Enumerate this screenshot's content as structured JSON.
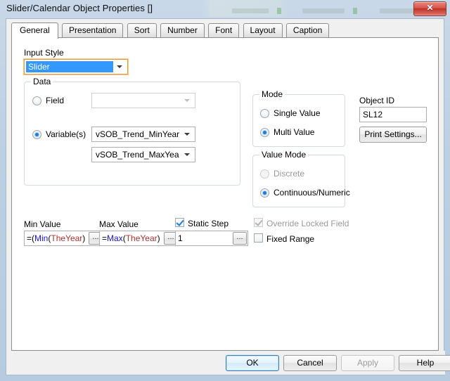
{
  "window": {
    "title": "Slider/Calendar Object Properties []",
    "close_label": "✕"
  },
  "tabs": [
    {
      "label": "General",
      "active": true
    },
    {
      "label": "Presentation",
      "active": false
    },
    {
      "label": "Sort",
      "active": false
    },
    {
      "label": "Number",
      "active": false
    },
    {
      "label": "Font",
      "active": false
    },
    {
      "label": "Layout",
      "active": false
    },
    {
      "label": "Caption",
      "active": false
    }
  ],
  "general": {
    "input_style": {
      "label": "Input Style",
      "value": "Slider"
    },
    "data_group": {
      "title": "Data",
      "field_radio_label": "Field",
      "field_combo_value": "",
      "variables_radio_label": "Variable(s)",
      "variable_1": "vSOB_Trend_MinYear",
      "variable_2": "vSOB_Trend_MaxYear"
    },
    "mode_group": {
      "title": "Mode",
      "options": [
        "Single Value",
        "Multi Value"
      ],
      "selected": "Multi Value"
    },
    "value_mode_group": {
      "title": "Value Mode",
      "options": [
        "Discrete",
        "Continuous/Numeric"
      ],
      "selected": "Continuous/Numeric",
      "disabled_option": "Discrete"
    },
    "object_id": {
      "label": "Object ID",
      "value": "SL12",
      "print_settings_label": "Print Settings..."
    },
    "min_value": {
      "label": "Min Value",
      "tokens": [
        {
          "t": "=(",
          "c": "black"
        },
        {
          "t": "Min",
          "c": "fn"
        },
        {
          "t": "(",
          "c": "black"
        },
        {
          "t": "TheYear",
          "c": "field"
        },
        {
          "t": ")",
          "c": "black"
        }
      ],
      "browse_label": "..."
    },
    "max_value": {
      "label": "Max Value",
      "tokens": [
        {
          "t": "=",
          "c": "black"
        },
        {
          "t": "Max",
          "c": "fn"
        },
        {
          "t": "(",
          "c": "black"
        },
        {
          "t": "TheYear",
          "c": "field"
        },
        {
          "t": ")",
          "c": "black"
        }
      ],
      "browse_label": "..."
    },
    "static_step": {
      "label": "Static Step",
      "checked": true,
      "value": "1",
      "browse_label": "..."
    },
    "override_locked_field": {
      "label": "Override Locked Field",
      "checked": true,
      "enabled": false
    },
    "fixed_range": {
      "label": "Fixed Range",
      "checked": false,
      "enabled": true
    }
  },
  "footer": {
    "ok": "OK",
    "cancel": "Cancel",
    "apply": "Apply",
    "help": "Help"
  },
  "colors": {
    "selection_blue": "#3399ff",
    "default_button_border": "#2e7ec1",
    "expression_function": "#1515cf",
    "expression_field": "#b03030",
    "radio_dot": "#1880d8",
    "close_button_red": "#c32f26"
  }
}
